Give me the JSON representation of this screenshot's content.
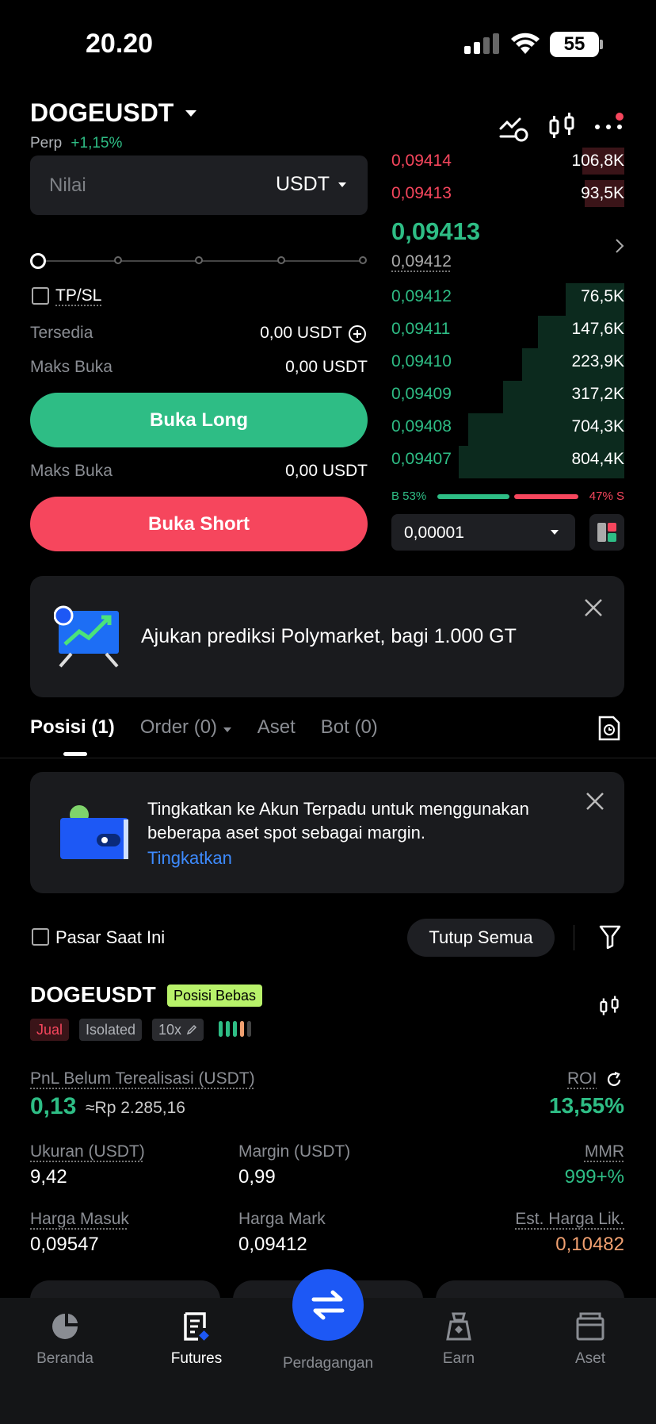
{
  "status_bar": {
    "time": "20.20",
    "battery": "55"
  },
  "header": {
    "symbol": "DOGEUSDT",
    "type": "Perp",
    "change": "+1,15%"
  },
  "form": {
    "amount_placeholder": "Nilai",
    "unit": "USDT",
    "tpsl_label": "TP/SL",
    "available_label": "Tersedia",
    "available_value": "0,00 USDT",
    "max_open_label": "Maks Buka",
    "max_open_long": "0,00 USDT",
    "open_long": "Buka Long",
    "max_open_short": "0,00 USDT",
    "open_short": "Buka Short"
  },
  "orderbook": {
    "asks": [
      {
        "price": "0,09414",
        "qty": "106,8K",
        "depth": 0.18
      },
      {
        "price": "0,09413",
        "qty": "93,5K",
        "depth": 0.17
      }
    ],
    "last_price": "0,09413",
    "mark_price": "0,09412",
    "bids": [
      {
        "price": "0,09412",
        "qty": "76,5K",
        "depth": 0.25
      },
      {
        "price": "0,09411",
        "qty": "147,6K",
        "depth": 0.37
      },
      {
        "price": "0,09410",
        "qty": "223,9K",
        "depth": 0.44
      },
      {
        "price": "0,09409",
        "qty": "317,2K",
        "depth": 0.52
      },
      {
        "price": "0,09408",
        "qty": "704,3K",
        "depth": 0.67
      },
      {
        "price": "0,09407",
        "qty": "804,4K",
        "depth": 0.71
      }
    ],
    "buy_ratio_label": "B 53%",
    "sell_ratio_label": "47% S",
    "buy_ratio": 0.53,
    "tick_size": "0,00001"
  },
  "promo": {
    "text": "Ajukan prediksi Polymarket, bagi 1.000 GT"
  },
  "tabs": [
    {
      "label": "Posisi (1)"
    },
    {
      "label": "Order (0)"
    },
    {
      "label": "Aset"
    },
    {
      "label": "Bot (0)"
    }
  ],
  "upgrade_banner": {
    "text": "Tingkatkan ke Akun Terpadu untuk menggunakan beberapa aset spot sebagai margin.",
    "link": "Tingkatkan"
  },
  "filters": {
    "current_market": "Pasar Saat Ini",
    "close_all": "Tutup Semua"
  },
  "position": {
    "symbol": "DOGEUSDT",
    "badge": "Posisi Bebas",
    "side": "Jual",
    "margin_mode": "Isolated",
    "leverage": "10x",
    "pnl_label": "PnL Belum Terealisasi (USDT)",
    "pnl_value": "0,13",
    "pnl_idr": "≈Rp 2.285,16",
    "roi_label": "ROI",
    "roi_value": "13,55%",
    "size_label": "Ukuran (USDT)",
    "size_value": "9,42",
    "margin_label": "Margin (USDT)",
    "margin_value": "0,99",
    "mmr_label": "MMR",
    "mmr_value": "999+%",
    "entry_label": "Harga Masuk",
    "entry_value": "0,09547",
    "mark_label": "Harga Mark",
    "mark_value": "0,09412",
    "liq_label": "Est. Harga Lik.",
    "liq_value": "0,10482"
  },
  "bottom_nav": [
    {
      "label": "Beranda",
      "icon": "home-icon"
    },
    {
      "label": "Futures",
      "icon": "futures-icon"
    },
    {
      "label": "Perdagangan",
      "icon": "swap-icon"
    },
    {
      "label": "Earn",
      "icon": "earn-icon"
    },
    {
      "label": "Aset",
      "icon": "wallet-icon"
    }
  ],
  "colors": {
    "green": "#2ebd85",
    "red": "#f6465d",
    "blue": "#1d58f5",
    "orange": "#f0a070"
  }
}
